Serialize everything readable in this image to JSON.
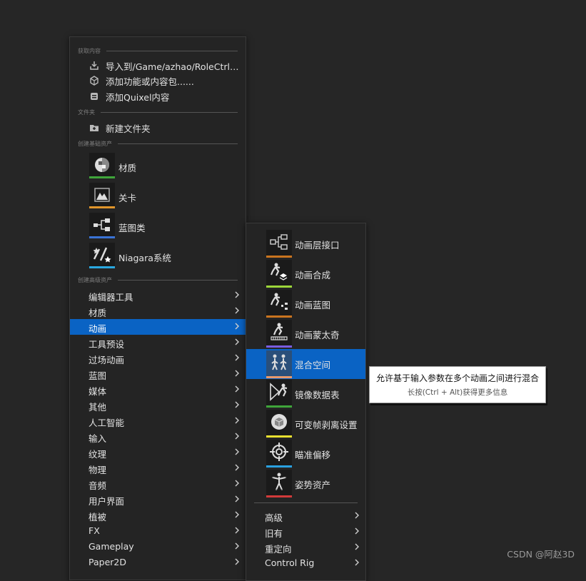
{
  "main_menu": {
    "section_get": "获取内容",
    "import": "导入到/Game/azhao/RoleCtrl......",
    "add_feature": "添加功能或内容包......",
    "add_quixel": "添加Quixel内容",
    "section_folder": "文件夹",
    "new_folder": "新建文件夹",
    "section_basic": "创建基础资产",
    "basic_assets": [
      {
        "label": "材质",
        "color": "#3fa53a",
        "icon": "material-icon"
      },
      {
        "label": "关卡",
        "color": "#e0952b",
        "icon": "level-icon"
      },
      {
        "label": "蓝图类",
        "color": "#3a73d6",
        "icon": "blueprint-class-icon"
      },
      {
        "label": "Niagara系统",
        "color": "#2aa8e0",
        "icon": "niagara-icon"
      }
    ],
    "section_advanced": "创建高级资产",
    "categories": [
      "编辑器工具",
      "材质",
      "动画",
      "工具预设",
      "过场动画",
      "蓝图",
      "媒体",
      "其他",
      "人工智能",
      "输入",
      "纹理",
      "物理",
      "音频",
      "用户界面",
      "植被",
      "FX",
      "Gameplay",
      "Paper2D"
    ],
    "active_category": "动画"
  },
  "sub_menu": {
    "assets": [
      {
        "label": "动画层接口",
        "color": "#c9741f",
        "icon": "anim-layer-interface-icon"
      },
      {
        "label": "动画合成",
        "color": "#9cd63a",
        "icon": "anim-composite-icon"
      },
      {
        "label": "动画蓝图",
        "color": "#c9741f",
        "icon": "anim-blueprint-icon"
      },
      {
        "label": "动画蒙太奇",
        "color": "#7a5ce0",
        "icon": "anim-montage-icon"
      },
      {
        "label": "混合空间",
        "color": "#e89a6e",
        "icon": "blend-space-icon"
      },
      {
        "label": "镜像数据表",
        "color": "#3fa53a",
        "icon": "mirror-table-icon"
      },
      {
        "label": "可变帧剥离设置",
        "color": "#e8e030",
        "icon": "frame-stripping-icon"
      },
      {
        "label": "瞄准偏移",
        "color": "#2aa0e0",
        "icon": "aim-offset-icon"
      },
      {
        "label": "姿势资产",
        "color": "#d23a3a",
        "icon": "pose-asset-icon"
      }
    ],
    "active_asset": "混合空间",
    "more": [
      "高级",
      "旧有",
      "重定向",
      "Control Rig"
    ]
  },
  "tooltip": {
    "line1": "允许基于输入参数在多个动画之间进行混合",
    "line2": "长按(Ctrl + Alt)获得更多信息"
  },
  "watermark": "CSDN @阿赵3D"
}
